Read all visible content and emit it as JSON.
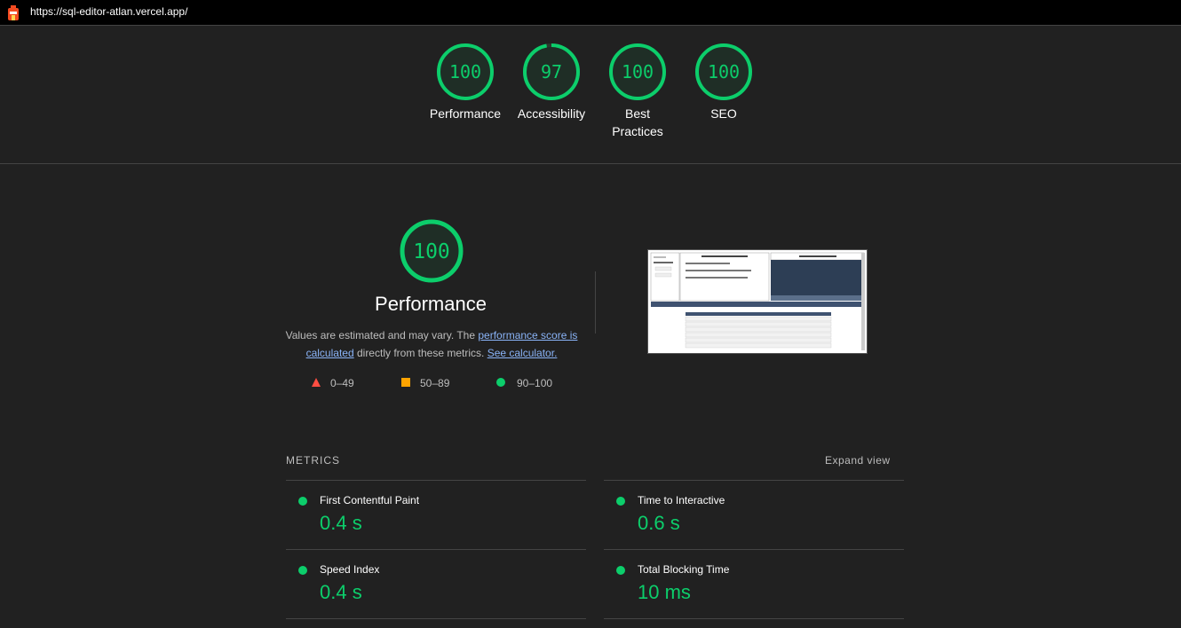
{
  "url_bar": {
    "url": "https://sql-editor-atlan.vercel.app/"
  },
  "colors": {
    "pass": "#0cce6b",
    "average": "#ffa400",
    "fail": "#ff4e42",
    "background": "#212121"
  },
  "gauges": [
    {
      "score": "100",
      "score_fraction": 1.0,
      "label": "Performance"
    },
    {
      "score": "97",
      "score_fraction": 0.97,
      "label": "Accessibility"
    },
    {
      "score": "100",
      "score_fraction": 1.0,
      "label_line1": "Best",
      "label_line2": "Practices"
    },
    {
      "score": "100",
      "score_fraction": 1.0,
      "label": "SEO"
    }
  ],
  "performance": {
    "score": "100",
    "title": "Performance",
    "desc_part1": "Values are estimated and may vary. The ",
    "link_score": "performance score is calculated",
    "desc_part2": " directly from these metrics. ",
    "link_calc": "See calculator.",
    "legend": [
      {
        "icon": "triangle-icon",
        "range": "0–49"
      },
      {
        "icon": "square-icon",
        "range": "50–89"
      },
      {
        "icon": "circle-icon",
        "range": "90–100"
      }
    ]
  },
  "metrics": {
    "heading": "METRICS",
    "expand_label": "Expand view",
    "items": [
      {
        "name": "First Contentful Paint",
        "value": "0.4 s"
      },
      {
        "name": "Time to Interactive",
        "value": "0.6 s"
      },
      {
        "name": "Speed Index",
        "value": "0.4 s"
      },
      {
        "name": "Total Blocking Time",
        "value": "10 ms"
      }
    ]
  }
}
